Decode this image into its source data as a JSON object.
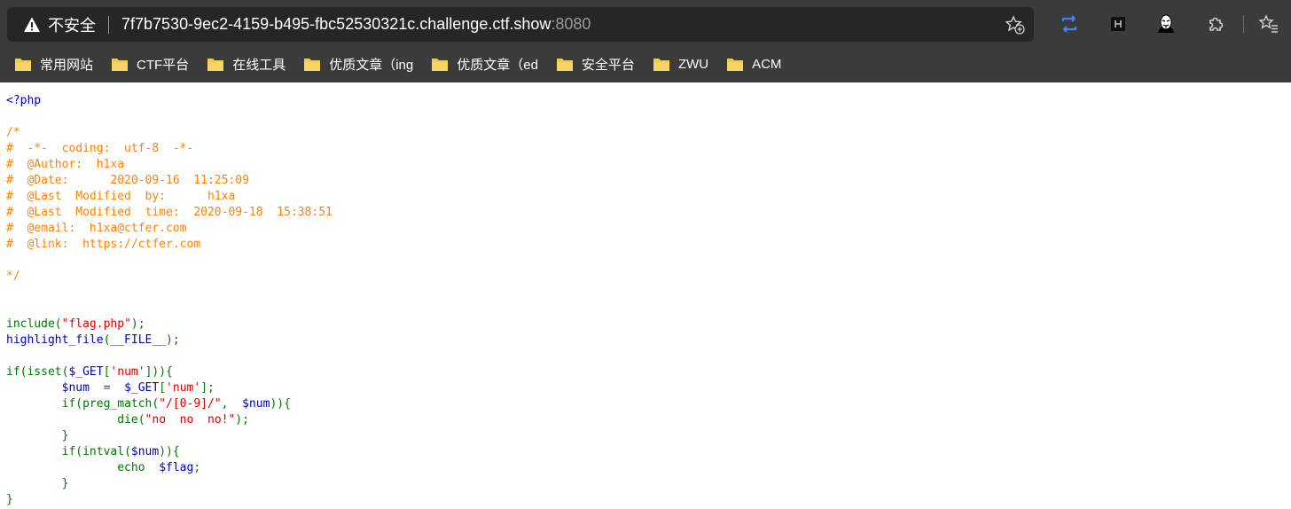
{
  "browser": {
    "security_label": "不安全",
    "url_host": "7f7b7530-9ec2-4159-b495-fbc52530321c.challenge.ctf.show",
    "url_port": ":8080",
    "colors": {
      "chrome": "#3b3b3b",
      "omnibox": "#262626",
      "accent": "#3b82f6"
    },
    "icons": [
      "warning-icon",
      "add-favorite-icon",
      "collections-icon",
      "hackbar-extension-icon",
      "anonymous-extension-icon",
      "extensions-icon",
      "favorites-icon"
    ]
  },
  "bookmarks": [
    {
      "label": "常用网站"
    },
    {
      "label": "CTF平台"
    },
    {
      "label": "在线工具"
    },
    {
      "label": "优质文章（ing"
    },
    {
      "label": "优质文章（ed"
    },
    {
      "label": "安全平台"
    },
    {
      "label": "ZWU"
    },
    {
      "label": "ACM"
    }
  ],
  "code": {
    "colors": {
      "default": "#0000bb",
      "comment": "#ff8000",
      "keyword": "#007700",
      "string": "#dd0000"
    },
    "open_tag": "<?php",
    "comment_lines": [
      "/*",
      "#  -*-  coding:  utf-8  -*-",
      "#  @Author:  h1xa",
      "#  @Date:      2020-09-16  11:25:09",
      "#  @Last  Modified  by:      h1xa",
      "#  @Last  Modified  time:  2020-09-18  15:38:51",
      "#  @email:  h1xa@ctfer.com",
      "#  @link:  https://ctfer.com",
      "",
      "*/"
    ],
    "include_kw": "include(",
    "include_str": "\"flag.php\"",
    "include_end": ");",
    "highlight_fn": "highlight_file",
    "highlight_open": "(",
    "highlight_arg": "__FILE__",
    "highlight_end": ");",
    "if1_kw": "if(isset(",
    "if1_var": "$_GET",
    "bracket_open": "[",
    "num_str": "'num'",
    "if1_end": "])){",
    "assign_var": "$num",
    "assign_eq": "  =  ",
    "assign_get": "$_GET",
    "assign_end": "];",
    "preg_kw": "if(preg_match(",
    "preg_str": "\"/[0-9]/\"",
    "preg_comma": ",  ",
    "preg_var": "$num",
    "preg_end": ")){",
    "die_kw": "die(",
    "die_str": "\"no  no  no!\"",
    "die_end": ");",
    "close_brace": "}",
    "intval_kw": "if(intval(",
    "intval_var": "$num",
    "intval_end": ")){",
    "echo_kw": "echo  ",
    "echo_var": "$flag",
    "echo_end": ";"
  }
}
